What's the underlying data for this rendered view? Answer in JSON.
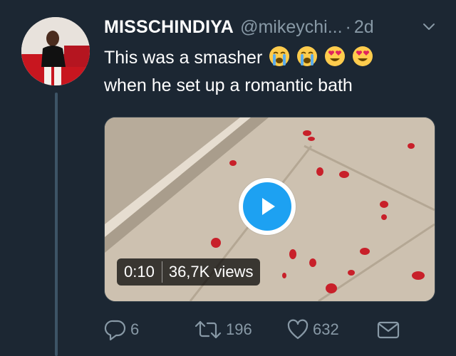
{
  "tweet": {
    "display_name": "MISSCHINDIYA",
    "handle": "@mikeychi...",
    "separator": "·",
    "time": "2d",
    "text_line1": "This was a smasher",
    "text_line2": "when he set up a romantic bath",
    "emojis": [
      "loudly-crying-face-emoji",
      "loudly-crying-face-emoji",
      "smiling-face-with-heart-eyes-emoji",
      "smiling-face-with-heart-eyes-emoji"
    ]
  },
  "video": {
    "duration": "0:10",
    "views": "36,7K views"
  },
  "actions": {
    "replies": "6",
    "retweets": "196",
    "likes": "632"
  },
  "colors": {
    "background": "#1c2733",
    "secondary_text": "#8899a6",
    "accent": "#1da1f2"
  }
}
